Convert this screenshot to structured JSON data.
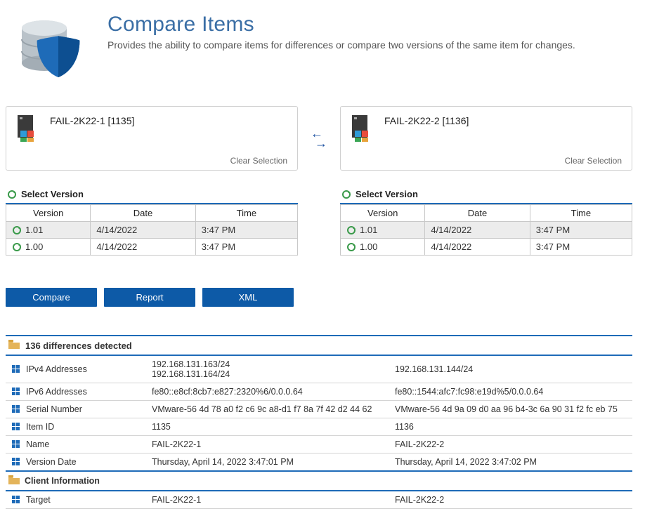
{
  "header": {
    "title": "Compare Items",
    "subtitle": "Provides the ability to compare items for differences or compare two versions of the same item for changes."
  },
  "left_item": {
    "name": "FAIL-2K22-1 [1135]",
    "clear": "Clear Selection"
  },
  "right_item": {
    "name": "FAIL-2K22-2 [1136]",
    "clear": "Clear Selection"
  },
  "version_section_label": "Select Version",
  "version_headers": {
    "version": "Version",
    "date": "Date",
    "time": "Time"
  },
  "left_versions": [
    {
      "version": "1.01",
      "date": "4/14/2022",
      "time": "3:47 PM",
      "selected": true
    },
    {
      "version": "1.00",
      "date": "4/14/2022",
      "time": "3:47 PM",
      "selected": false
    }
  ],
  "right_versions": [
    {
      "version": "1.01",
      "date": "4/14/2022",
      "time": "3:47 PM",
      "selected": true
    },
    {
      "version": "1.00",
      "date": "4/14/2022",
      "time": "3:47 PM",
      "selected": false
    }
  ],
  "buttons": {
    "compare": "Compare",
    "report": "Report",
    "xml": "XML"
  },
  "diff": {
    "summary": "136 differences detected",
    "rows": [
      {
        "label": "IPv4 Addresses",
        "left": "192.168.131.163/24\n192.168.131.164/24",
        "right": "192.168.131.144/24"
      },
      {
        "label": "IPv6 Addresses",
        "left": "fe80::e8cf:8cb7:e827:2320%6/0.0.0.64",
        "right": "fe80::1544:afc7:fc98:e19d%5/0.0.0.64"
      },
      {
        "label": "Serial Number",
        "left": "VMware-56 4d 78 a0 f2 c6 9c a8-d1 f7 8a 7f 42 d2 44 62",
        "right": "VMware-56 4d 9a 09 d0 aa 96 b4-3c 6a 90 31 f2 fc eb 75"
      },
      {
        "label": "Item ID",
        "left": "1135",
        "right": "1136"
      },
      {
        "label": "Name",
        "left": "FAIL-2K22-1",
        "right": "FAIL-2K22-2"
      },
      {
        "label": "Version Date",
        "left": "Thursday, April 14, 2022 3:47:01 PM",
        "right": "Thursday, April 14, 2022 3:47:02 PM"
      }
    ],
    "subsection": "Client Information",
    "sub_rows": [
      {
        "label": "Target",
        "left": "FAIL-2K22-1",
        "right": "FAIL-2K22-2"
      }
    ]
  }
}
